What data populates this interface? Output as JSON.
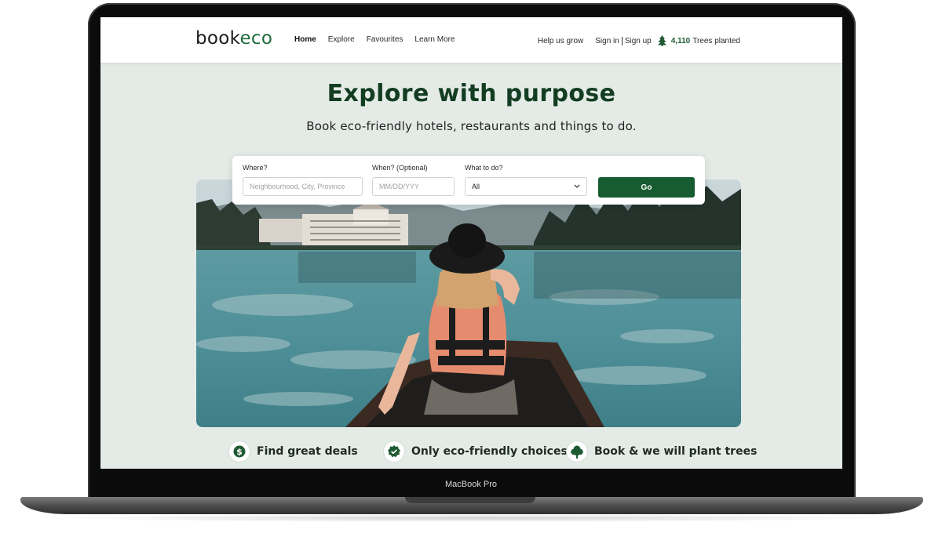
{
  "device": {
    "label": "MacBook Pro"
  },
  "nav": {
    "logo_book": "book",
    "logo_eco": "eco",
    "links": [
      "Home",
      "Explore",
      "Favourites",
      "Learn More"
    ],
    "help": "Help us grow",
    "sign_in": "Sign in",
    "sign_up": "Sign up",
    "trees_count": "4,110",
    "trees_label": "Trees planted"
  },
  "hero": {
    "title": "Explore with purpose",
    "subtitle": "Book eco-friendly hotels, restaurants and things to do."
  },
  "search": {
    "where_label": "Where?",
    "where_placeholder": "Neighbourhood, City, Province",
    "when_label": "When? (Optional)",
    "when_placeholder": "MM/DD/YYY",
    "what_label": "What to do?",
    "what_value": "All",
    "go_label": "Go"
  },
  "features": [
    {
      "icon": "dollar-icon",
      "text": "Find great deals"
    },
    {
      "icon": "check-badge-icon",
      "text": "Only eco-friendly choices"
    },
    {
      "icon": "tree-icon",
      "text": "Book & we will plant trees"
    }
  ],
  "colors": {
    "brand_green": "#175b30",
    "title_green": "#133d22",
    "page_bg": "#e4ebe6"
  }
}
